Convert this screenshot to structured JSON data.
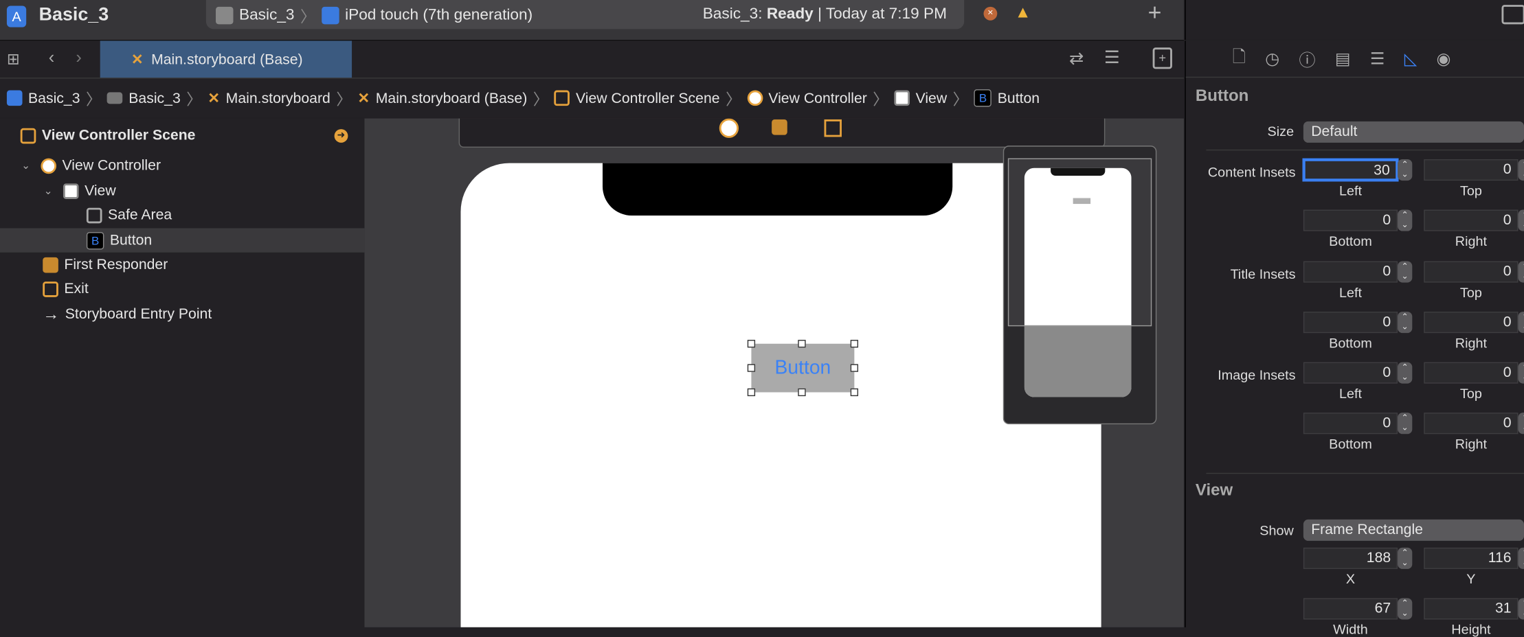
{
  "window": {
    "project": "Basic_3",
    "scheme": "Basic_3",
    "device": "iPod touch (7th generation)",
    "status_project": "Basic_3:",
    "status_state": "Ready",
    "status_sep": "|",
    "status_time": "Today at 7:19 PM"
  },
  "tab": {
    "label": "Main.storyboard (Base)"
  },
  "breadcrumb": [
    "Basic_3",
    "Basic_3",
    "Main.storyboard",
    "Main.storyboard (Base)",
    "View Controller Scene",
    "View Controller",
    "View",
    "Button"
  ],
  "outline": [
    {
      "label": "View Controller Scene"
    },
    {
      "label": "View Controller"
    },
    {
      "label": "View"
    },
    {
      "label": "Safe Area"
    },
    {
      "label": "Button",
      "selected": true
    },
    {
      "label": "First Responder"
    },
    {
      "label": "Exit"
    },
    {
      "label": "Storyboard Entry Point"
    }
  ],
  "canvas": {
    "button_label": "Button"
  },
  "inspector": {
    "section_button": "Button",
    "size_label": "Size",
    "size_value": "Default",
    "insets": [
      {
        "label": "Content Insets",
        "left": "30",
        "top": "0",
        "bottom": "0",
        "right": "0"
      },
      {
        "label": "Title Insets",
        "left": "0",
        "top": "0",
        "bottom": "0",
        "right": "0"
      },
      {
        "label": "Image Insets",
        "left": "0",
        "top": "0",
        "bottom": "0",
        "right": "0"
      }
    ],
    "sub": {
      "left": "Left",
      "top": "Top",
      "bottom": "Bottom",
      "right": "Right"
    },
    "section_view": "View",
    "show_label": "Show",
    "show_value": "Frame Rectangle",
    "x": "188",
    "y": "116",
    "x_label": "X",
    "y_label": "Y",
    "width": "67",
    "height": "31",
    "width_label": "Width",
    "height_label": "Height"
  },
  "colors": {
    "accent": "#3b82f6",
    "tab": "#3b5a80",
    "orange": "#e6a23c"
  }
}
